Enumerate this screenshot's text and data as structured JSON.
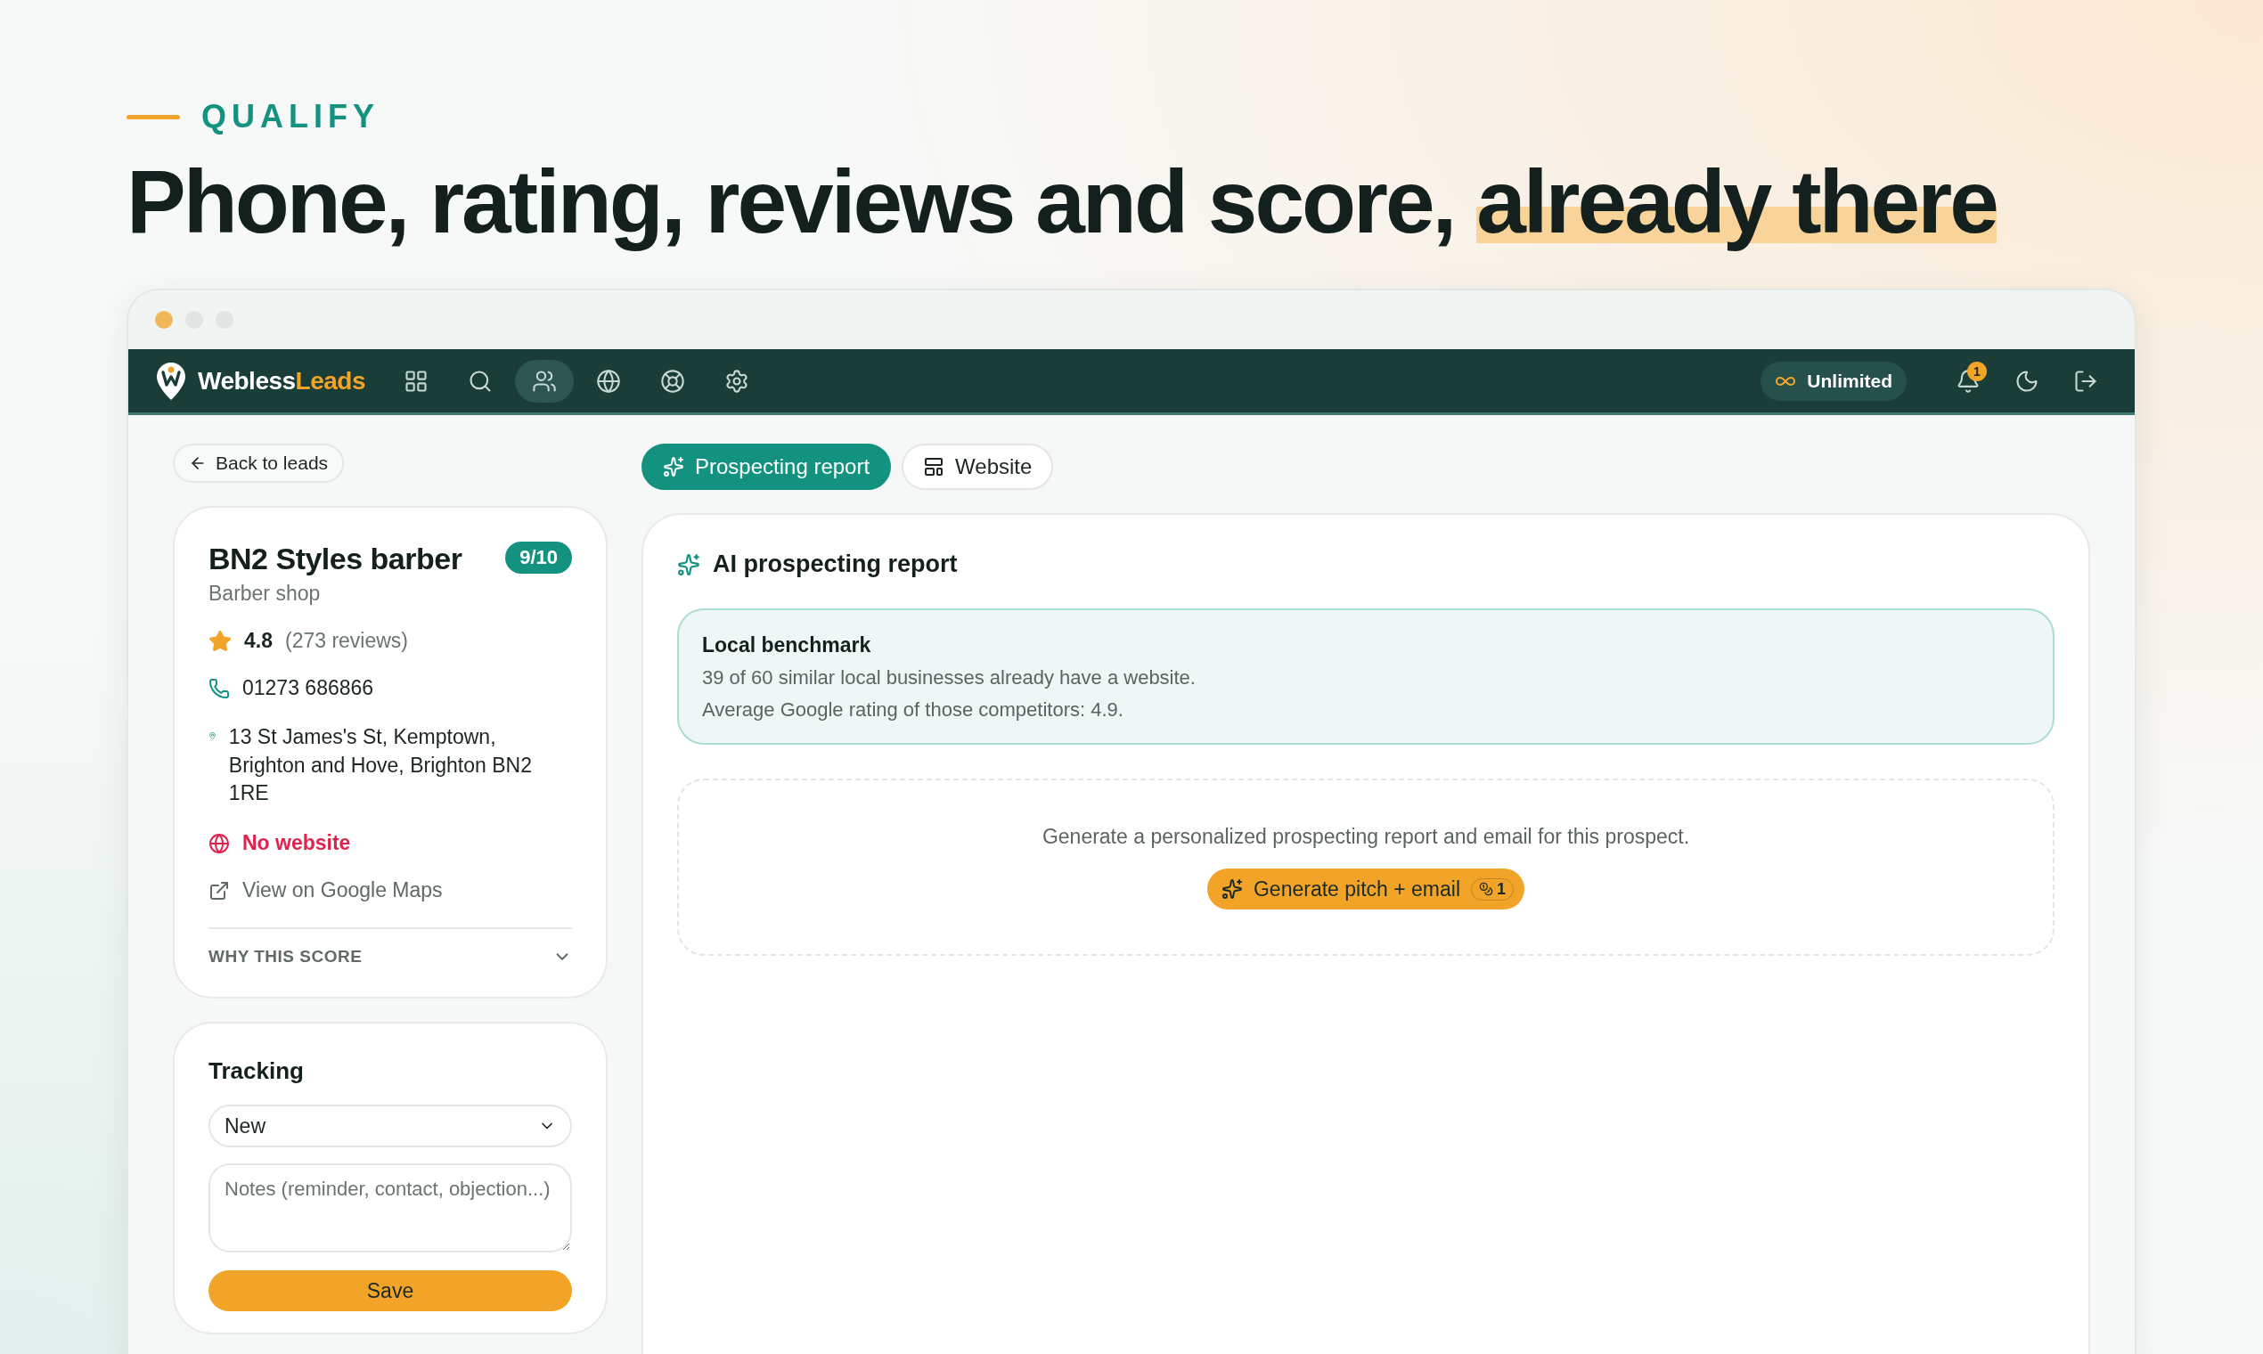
{
  "eyebrow": "QUALIFY",
  "headline": {
    "text": "Phone, rating, reviews and score,",
    "highlight": "already there"
  },
  "browser": {
    "dots": [
      {
        "color": "#f2b65a"
      },
      {
        "color": "#dfe6e4"
      },
      {
        "color": "#dfe6e4"
      }
    ]
  },
  "navbar": {
    "brand": {
      "name": "Webless",
      "accent": "Leads"
    },
    "nav_items": [
      {
        "kind": "grid",
        "selected": false
      },
      {
        "kind": "search",
        "selected": false
      },
      {
        "kind": "people",
        "selected": true
      },
      {
        "kind": "globe",
        "selected": false
      },
      {
        "kind": "support",
        "selected": false
      },
      {
        "kind": "settings",
        "selected": false
      }
    ],
    "plan": "Unlimited",
    "notifications": "1"
  },
  "back_button": "Back to leads",
  "lead": {
    "name": "BN2 Styles barber",
    "score": "9/10",
    "category": "Barber shop",
    "rating": "4.8",
    "reviews": "(273 reviews)",
    "phone": "01273 686866",
    "address": "13 St James's St, Kemptown, Brighton and Hove, Brighton BN2 1RE",
    "website_status": "No website",
    "maps_link": "View on Google Maps",
    "why_score": {
      "label": "WHY THIS SCORE",
      "expanded": false
    }
  },
  "tracking": {
    "title": "Tracking",
    "status": "New",
    "notes": {
      "placeholder": "Notes (reminder, contact, objection...)"
    },
    "save": "Save"
  },
  "tabs": [
    {
      "label": "Prospecting report",
      "kind": "sparkles",
      "selected": true
    },
    {
      "label": "Website",
      "kind": "layout",
      "selected": false
    }
  ],
  "report": {
    "title": "AI prospecting report",
    "benchmark": {
      "title": "Local benchmark",
      "lines": [
        "39 of 60 similar local businesses already have a website.",
        "Average Google rating of those competitors: 4.9."
      ]
    },
    "prompt": "Generate a personalized prospecting report and email for this prospect.",
    "generate": {
      "label": "Generate pitch + email",
      "credits": "1"
    }
  }
}
